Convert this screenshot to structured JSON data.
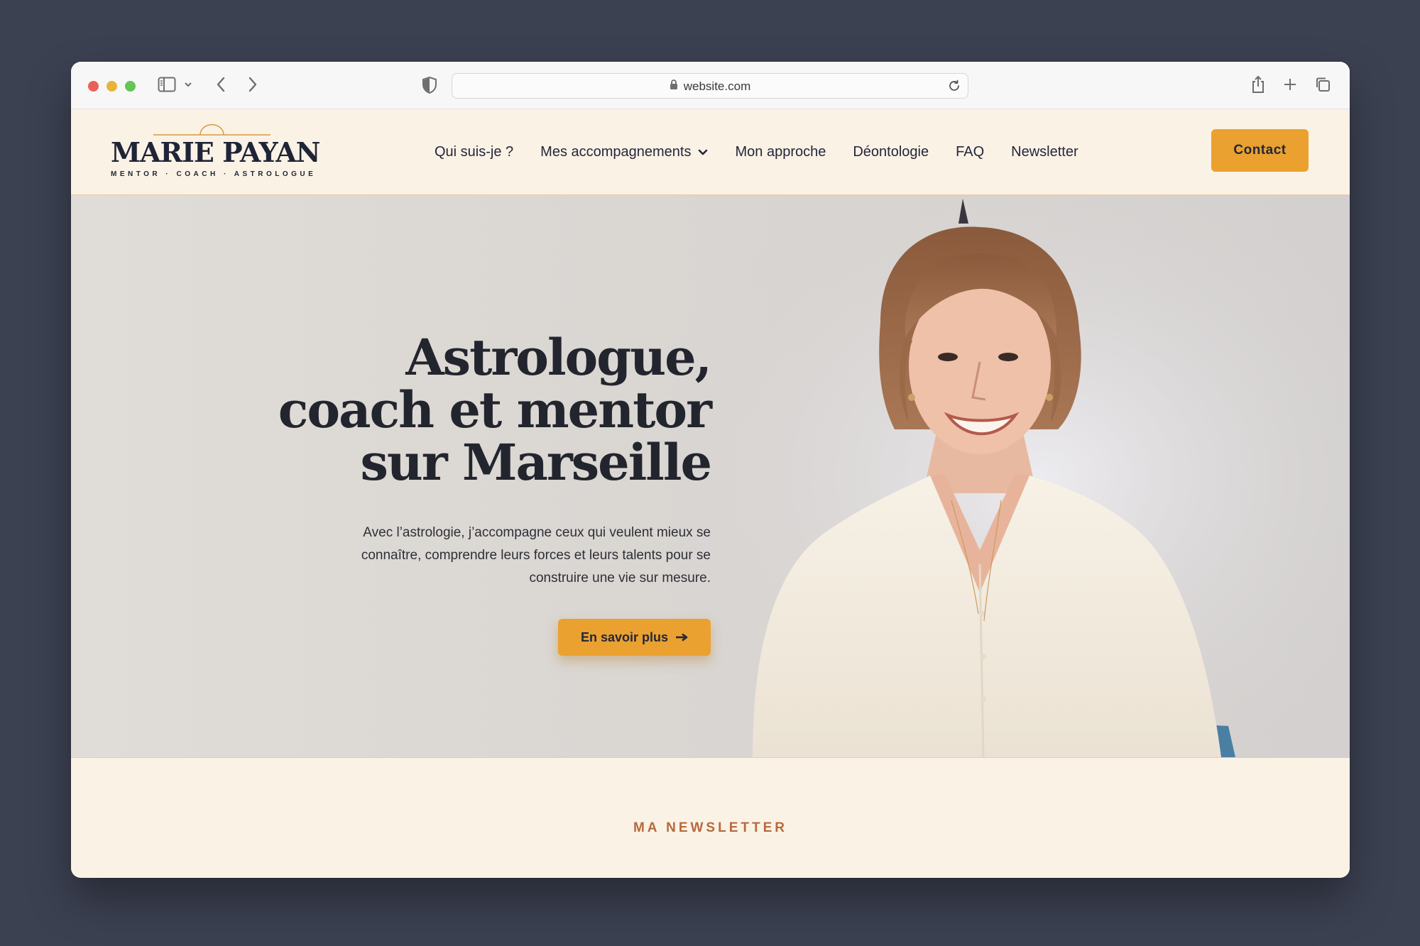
{
  "browser": {
    "url": "website.com"
  },
  "header": {
    "logo_name": "MARIE PAYAN",
    "logo_tagline": "MENTOR · COACH · ASTROLOGUE",
    "nav": [
      {
        "label": "Qui suis-je ?"
      },
      {
        "label": "Mes accompagnements"
      },
      {
        "label": "Mon approche"
      },
      {
        "label": "Déontologie"
      },
      {
        "label": "FAQ"
      },
      {
        "label": "Newsletter"
      }
    ],
    "contact_label": "Contact"
  },
  "hero": {
    "title_lines": [
      "Astrologue,",
      "coach et mentor",
      "sur Marseille"
    ],
    "text_lines": [
      "Avec l’astrologie, j’accompagne ceux qui veulent mieux se",
      "connaître, comprendre leurs forces et leurs talents pour se",
      "construire une vie sur mesure."
    ],
    "cta_label": "En savoir plus"
  },
  "newsletter": {
    "eyebrow": "MA NEWSLETTER"
  },
  "colors": {
    "accent": "#eba12f",
    "navy": "#1f2437",
    "cream": "#fbf2e6",
    "rust": "#b66a3d",
    "backdrop": "#3c4152"
  },
  "icons": {
    "window_controls": [
      "close-dot",
      "minimize-dot",
      "zoom-dot"
    ],
    "toolbar": [
      "sidebar-icon",
      "chevron-down-icon",
      "back-arrow-icon",
      "forward-arrow-icon",
      "shield-icon",
      "lock-icon",
      "reload-icon",
      "share-icon",
      "plus-icon",
      "tabs-icon"
    ],
    "nav_caret": "chevron-down-icon",
    "cta_arrow": "arrow-right-icon"
  }
}
